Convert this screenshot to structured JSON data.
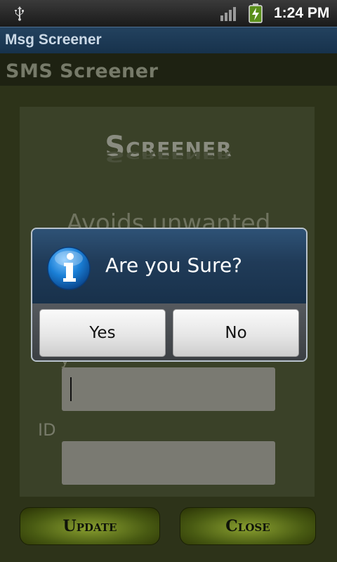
{
  "status_bar": {
    "time": "1:24 PM",
    "icons": [
      "usb-icon",
      "signal-icon",
      "battery-charging-icon"
    ]
  },
  "app": {
    "title": "Msg Screener"
  },
  "screen": {
    "header": "SMS Screener",
    "logo": "Screener",
    "tagline": "Avoids unwanted",
    "field_label_partial": "y",
    "id_label": "ID",
    "update_label": "Update",
    "close_label": "Close"
  },
  "dialog": {
    "icon": "info-icon",
    "title": "Are you Sure?",
    "yes_label": "Yes",
    "no_label": "No"
  },
  "colors": {
    "accent_green": "#6f8a1c",
    "dialog_header": "#203b58",
    "info_blue": "#1a7fd6"
  }
}
